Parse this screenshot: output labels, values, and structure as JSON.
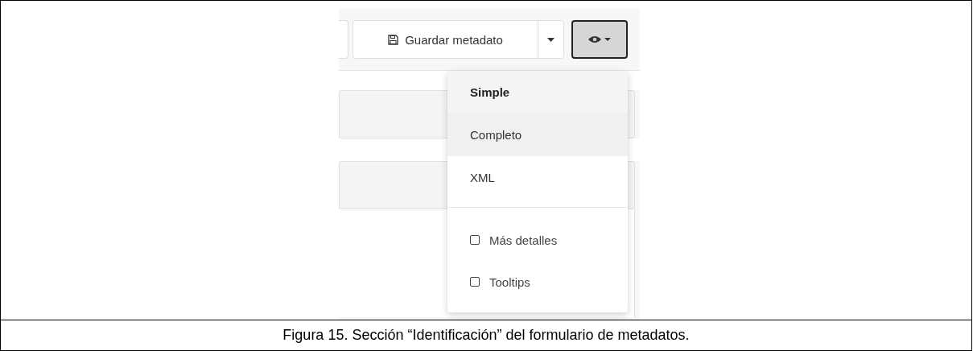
{
  "toolbar": {
    "save_button": {
      "label": "Guardar metadato"
    },
    "view_button": {
      "pressed": true
    }
  },
  "view_menu": {
    "items": [
      {
        "label": "Simple",
        "selected": true,
        "hovered": false
      },
      {
        "label": "Completo",
        "selected": false,
        "hovered": true
      },
      {
        "label": "XML",
        "selected": false,
        "hovered": false
      }
    ],
    "options": [
      {
        "label": "Más detalles",
        "checked": false
      },
      {
        "label": "Tooltips",
        "checked": false
      }
    ]
  },
  "caption": "Figura 15. Sección “Identificación” del formulario de metadatos."
}
